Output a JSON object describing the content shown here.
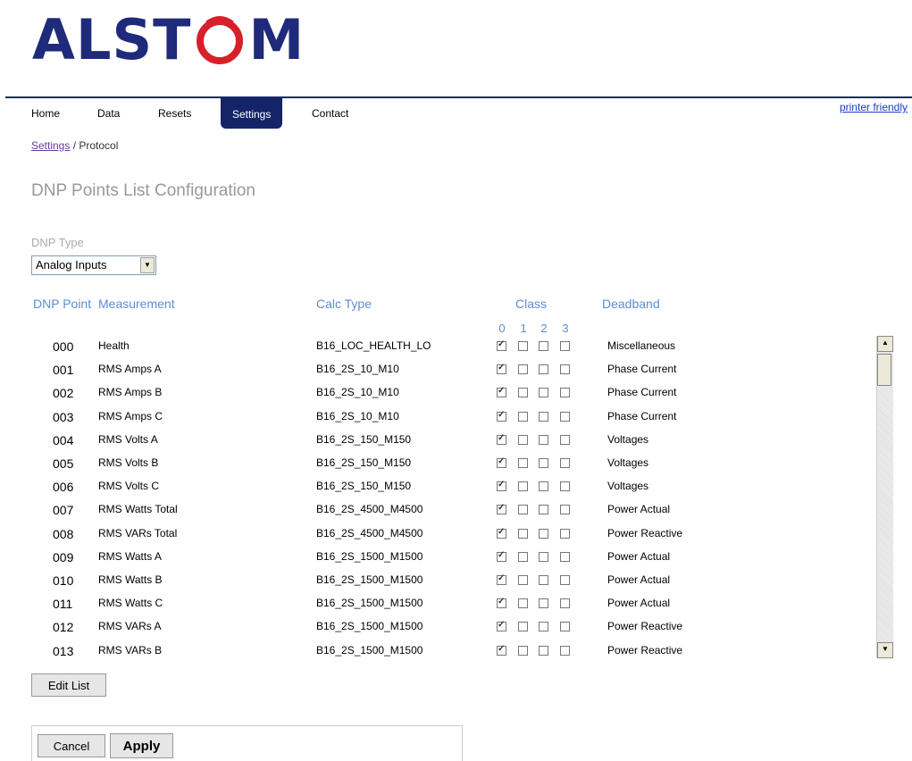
{
  "logo": {
    "text_a": "ALST",
    "text_b": "M",
    "text_o": "O"
  },
  "nav": {
    "items": [
      "Home",
      "Data",
      "Resets",
      "Settings",
      "Contact"
    ],
    "active": "Settings",
    "printer": "printer friendly"
  },
  "breadcrumb": {
    "link": "Settings",
    "sep": " / ",
    "current": "Protocol"
  },
  "title": "DNP Points List Configuration",
  "dnp_type": {
    "label": "DNP Type",
    "value": "Analog Inputs"
  },
  "headers": {
    "dnp_point": "DNP Point",
    "measurement": "Measurement",
    "calc_type": "Calc Type",
    "class": "Class",
    "deadband": "Deadband",
    "class_nums": [
      "0",
      "1",
      "2",
      "3"
    ]
  },
  "rows": [
    {
      "num": "000",
      "meas": "Health",
      "calc": "B16_LOC_HEALTH_LO",
      "classes": [
        true,
        false,
        false,
        false
      ],
      "dead": "Miscellaneous"
    },
    {
      "num": "001",
      "meas": "RMS Amps A",
      "calc": "B16_2S_10_M10",
      "classes": [
        true,
        false,
        false,
        false
      ],
      "dead": "Phase Current"
    },
    {
      "num": "002",
      "meas": "RMS Amps B",
      "calc": "B16_2S_10_M10",
      "classes": [
        true,
        false,
        false,
        false
      ],
      "dead": "Phase Current"
    },
    {
      "num": "003",
      "meas": "RMS Amps C",
      "calc": "B16_2S_10_M10",
      "classes": [
        true,
        false,
        false,
        false
      ],
      "dead": "Phase Current"
    },
    {
      "num": "004",
      "meas": "RMS Volts A",
      "calc": "B16_2S_150_M150",
      "classes": [
        true,
        false,
        false,
        false
      ],
      "dead": "Voltages"
    },
    {
      "num": "005",
      "meas": "RMS Volts B",
      "calc": "B16_2S_150_M150",
      "classes": [
        true,
        false,
        false,
        false
      ],
      "dead": "Voltages"
    },
    {
      "num": "006",
      "meas": "RMS Volts C",
      "calc": "B16_2S_150_M150",
      "classes": [
        true,
        false,
        false,
        false
      ],
      "dead": "Voltages"
    },
    {
      "num": "007",
      "meas": "RMS Watts Total",
      "calc": "B16_2S_4500_M4500",
      "classes": [
        true,
        false,
        false,
        false
      ],
      "dead": "Power Actual"
    },
    {
      "num": "008",
      "meas": "RMS VARs Total",
      "calc": "B16_2S_4500_M4500",
      "classes": [
        true,
        false,
        false,
        false
      ],
      "dead": "Power Reactive"
    },
    {
      "num": "009",
      "meas": "RMS Watts A",
      "calc": "B16_2S_1500_M1500",
      "classes": [
        true,
        false,
        false,
        false
      ],
      "dead": "Power Actual"
    },
    {
      "num": "010",
      "meas": "RMS Watts B",
      "calc": "B16_2S_1500_M1500",
      "classes": [
        true,
        false,
        false,
        false
      ],
      "dead": "Power Actual"
    },
    {
      "num": "011",
      "meas": "RMS Watts C",
      "calc": "B16_2S_1500_M1500",
      "classes": [
        true,
        false,
        false,
        false
      ],
      "dead": "Power Actual"
    },
    {
      "num": "012",
      "meas": "RMS VARs A",
      "calc": "B16_2S_1500_M1500",
      "classes": [
        true,
        false,
        false,
        false
      ],
      "dead": "Power Reactive"
    },
    {
      "num": "013",
      "meas": "RMS VARs B",
      "calc": "B16_2S_1500_M1500",
      "classes": [
        true,
        false,
        false,
        false
      ],
      "dead": "Power Reactive"
    }
  ],
  "buttons": {
    "edit_list": "Edit List",
    "cancel": "Cancel",
    "apply": "Apply"
  },
  "colors": {
    "brand_navy": "#1f2a7a",
    "brand_red": "#d6202a",
    "header_blue": "#5b8dd6"
  }
}
